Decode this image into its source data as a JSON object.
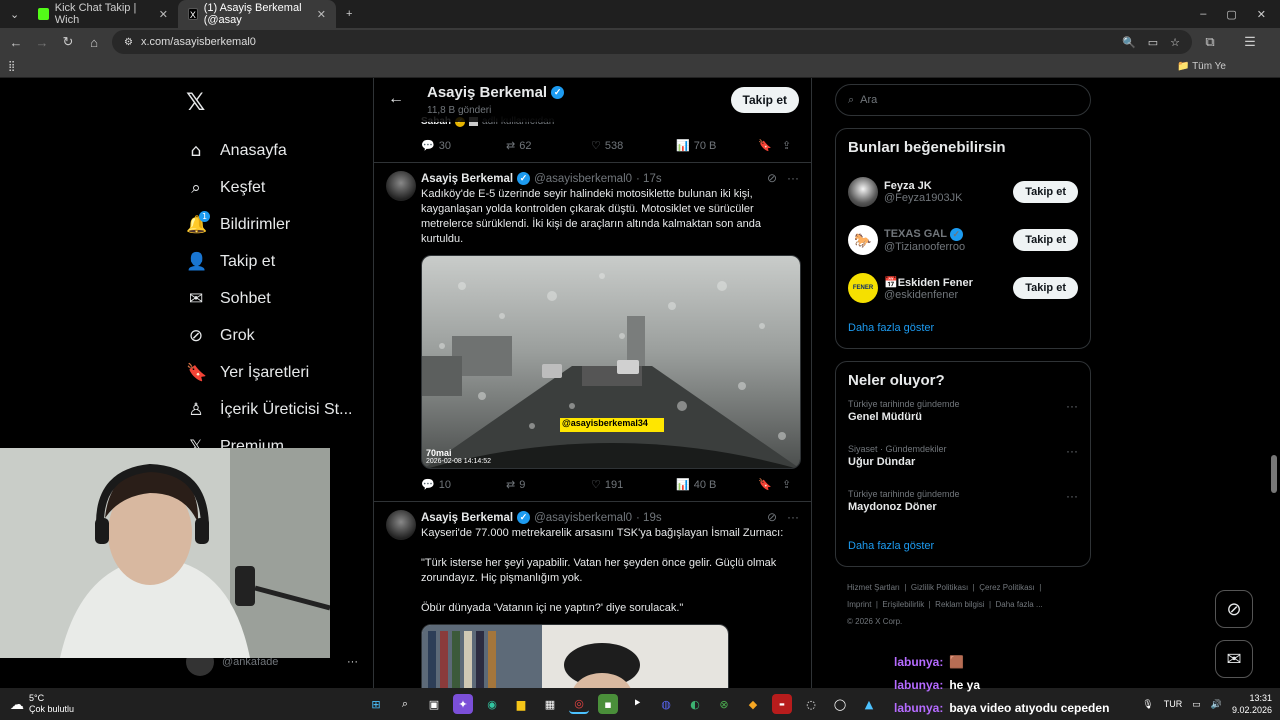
{
  "browser": {
    "tabs": [
      {
        "label": "Kick Chat Takip | Wich",
        "active": false
      },
      {
        "label": "(1) Asayiş Berkemal (@asay",
        "active": true
      }
    ],
    "url": "x.com/asayisberkemal0",
    "bookmarks_label": "Tüm Ye"
  },
  "leftnav": {
    "items": [
      {
        "label": "Anasayfa",
        "icon": "home-icon"
      },
      {
        "label": "Keşfet",
        "icon": "search-icon"
      },
      {
        "label": "Bildirimler",
        "icon": "bell-icon",
        "badge": "1"
      },
      {
        "label": "Takip et",
        "icon": "follow-icon"
      },
      {
        "label": "Sohbet",
        "icon": "mail-icon"
      },
      {
        "label": "Grok",
        "icon": "grok-icon"
      },
      {
        "label": "Yer İşaretleri",
        "icon": "bookmark-icon"
      },
      {
        "label": "İçerik Üreticisi St...",
        "icon": "creator-icon"
      },
      {
        "label": "Premium",
        "icon": "x-icon"
      }
    ],
    "account_handle": "@ankafade"
  },
  "profile_header": {
    "name": "Asayiş Berkemal",
    "posts": "11,8 B gönderi",
    "follow_label": "Takip et"
  },
  "quoted_top": {
    "source": "Sabah",
    "meta": "adlı kullanıcıdan",
    "replies": "30",
    "reposts": "62",
    "likes": "538",
    "views": "70 B"
  },
  "tweets": [
    {
      "name": "Asayiş Berkemal",
      "handle": "@asayisberkemal0",
      "time": "· 17s",
      "text": "Kadıköy'de E-5 üzerinde seyir halindeki motosiklette bulunan iki kişi, kayganlaşan yolda kontrolden çıkarak düştü. Motosiklet ve sürücüler metrelerce sürüklendi. İki kişi de araçların altında kalmaktan son anda kurtuldu.",
      "media_watermark": "@asayisberkemal34",
      "media_brand": "70mai",
      "media_timestamp": "2026-02-08 14:14:52",
      "replies": "10",
      "reposts": "9",
      "likes": "191",
      "views": "40 B"
    },
    {
      "name": "Asayiş Berkemal",
      "handle": "@asayisberkemal0",
      "time": "· 19s",
      "text": "Kayseri'de 77.000 metrekarelik arsasını TSK'ya bağışlayan İsmail Zurnacı:\n\n\"Türk isterse her şeyi yapabilir. Vatan her şeyden önce gelir. Güçlü olmak zorundayız. Hiç pişmanlığım yok.\n\nÖbür dünyada 'Vatanın içi ne yaptın?' diye sorulacak.\""
    }
  ],
  "sidebar": {
    "search_placeholder": "Ara",
    "suggest_title": "Bunları beğenebilirsin",
    "suggestions": [
      {
        "name": "Feyza JK",
        "handle": "@Feyza1903JK",
        "verified": false,
        "follow": "Takip et"
      },
      {
        "name": "TEXAS GAL",
        "handle": "@Tizianooferroo",
        "verified": true,
        "follow": "Takip et"
      },
      {
        "name": "📅Eskiden Fener",
        "handle": "@eskidenfener",
        "verified": false,
        "follow": "Takip et",
        "avatar_text": "FENER"
      }
    ],
    "show_more": "Daha fazla göster",
    "trends_title": "Neler oluyor?",
    "trends": [
      {
        "context": "Türkiye tarihinde gündemde",
        "topic": "Genel Müdürü"
      },
      {
        "context": "Siyaset · Gündemdekiler",
        "topic": "Uğur Dündar"
      },
      {
        "context": "Türkiye tarihinde gündemde",
        "topic": "Maydonoz Döner"
      }
    ],
    "trends_more": "Daha fazla göster",
    "footer": [
      "Hizmet Şartları",
      "Gizlilik Politikası",
      "Çerez Politikası",
      "Imprint",
      "Erişilebilirlik",
      "Reklam bilgisi",
      "Daha fazla ..."
    ],
    "copyright": "© 2026 X Corp."
  },
  "chat": [
    {
      "user": "labunya:",
      "msg": "🟫"
    },
    {
      "user": "labunya:",
      "msg": "he ya"
    },
    {
      "user": "labunya:",
      "msg": "baya video atıyodu cepeden"
    }
  ],
  "taskbar": {
    "temp": "5°C",
    "weather": "Çok bulutlu",
    "lang": "TUR",
    "time": "13:31",
    "date": "9.02.2026"
  }
}
